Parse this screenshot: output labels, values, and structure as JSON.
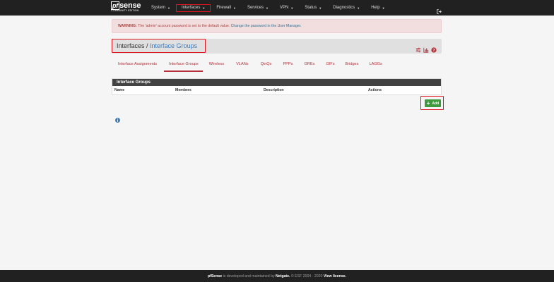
{
  "brand": {
    "logo_pf": "pf",
    "logo_rest": "sense",
    "edition": "COMMUNITY EDITION"
  },
  "nav": [
    {
      "label": "System"
    },
    {
      "label": "Interfaces"
    },
    {
      "label": "Firewall"
    },
    {
      "label": "Services"
    },
    {
      "label": "VPN"
    },
    {
      "label": "Status"
    },
    {
      "label": "Diagnostics"
    },
    {
      "label": "Help"
    }
  ],
  "alert": {
    "strong": "WARNING:",
    "text": " The 'admin' account password is set to the default value. ",
    "link": "Change the password in the User Manager."
  },
  "breadcrumb": {
    "parent": "Interfaces /",
    "current": "Interface Groups"
  },
  "tabs": [
    {
      "label": "Interface Assignments"
    },
    {
      "label": "Interface Groups"
    },
    {
      "label": "Wireless"
    },
    {
      "label": "VLANs"
    },
    {
      "label": "QinQs"
    },
    {
      "label": "PPPs"
    },
    {
      "label": "GREs"
    },
    {
      "label": "GIFs"
    },
    {
      "label": "Bridges"
    },
    {
      "label": "LAGGs"
    }
  ],
  "panel": {
    "title": "Interface Groups",
    "columns": [
      "Name",
      "Members",
      "Description",
      "Actions"
    ]
  },
  "add_button": {
    "label": "Add"
  },
  "footer": {
    "brand": "pfSense",
    "text": " is developed and maintained by ",
    "company": "Netgate.",
    "copy": " © ESF 2004 - 2020 ",
    "license": "View license."
  },
  "colors": {
    "navbar": "#212121",
    "accent": "#b2313a",
    "success": "#3f9a3f",
    "highlight": "#e0141e"
  }
}
